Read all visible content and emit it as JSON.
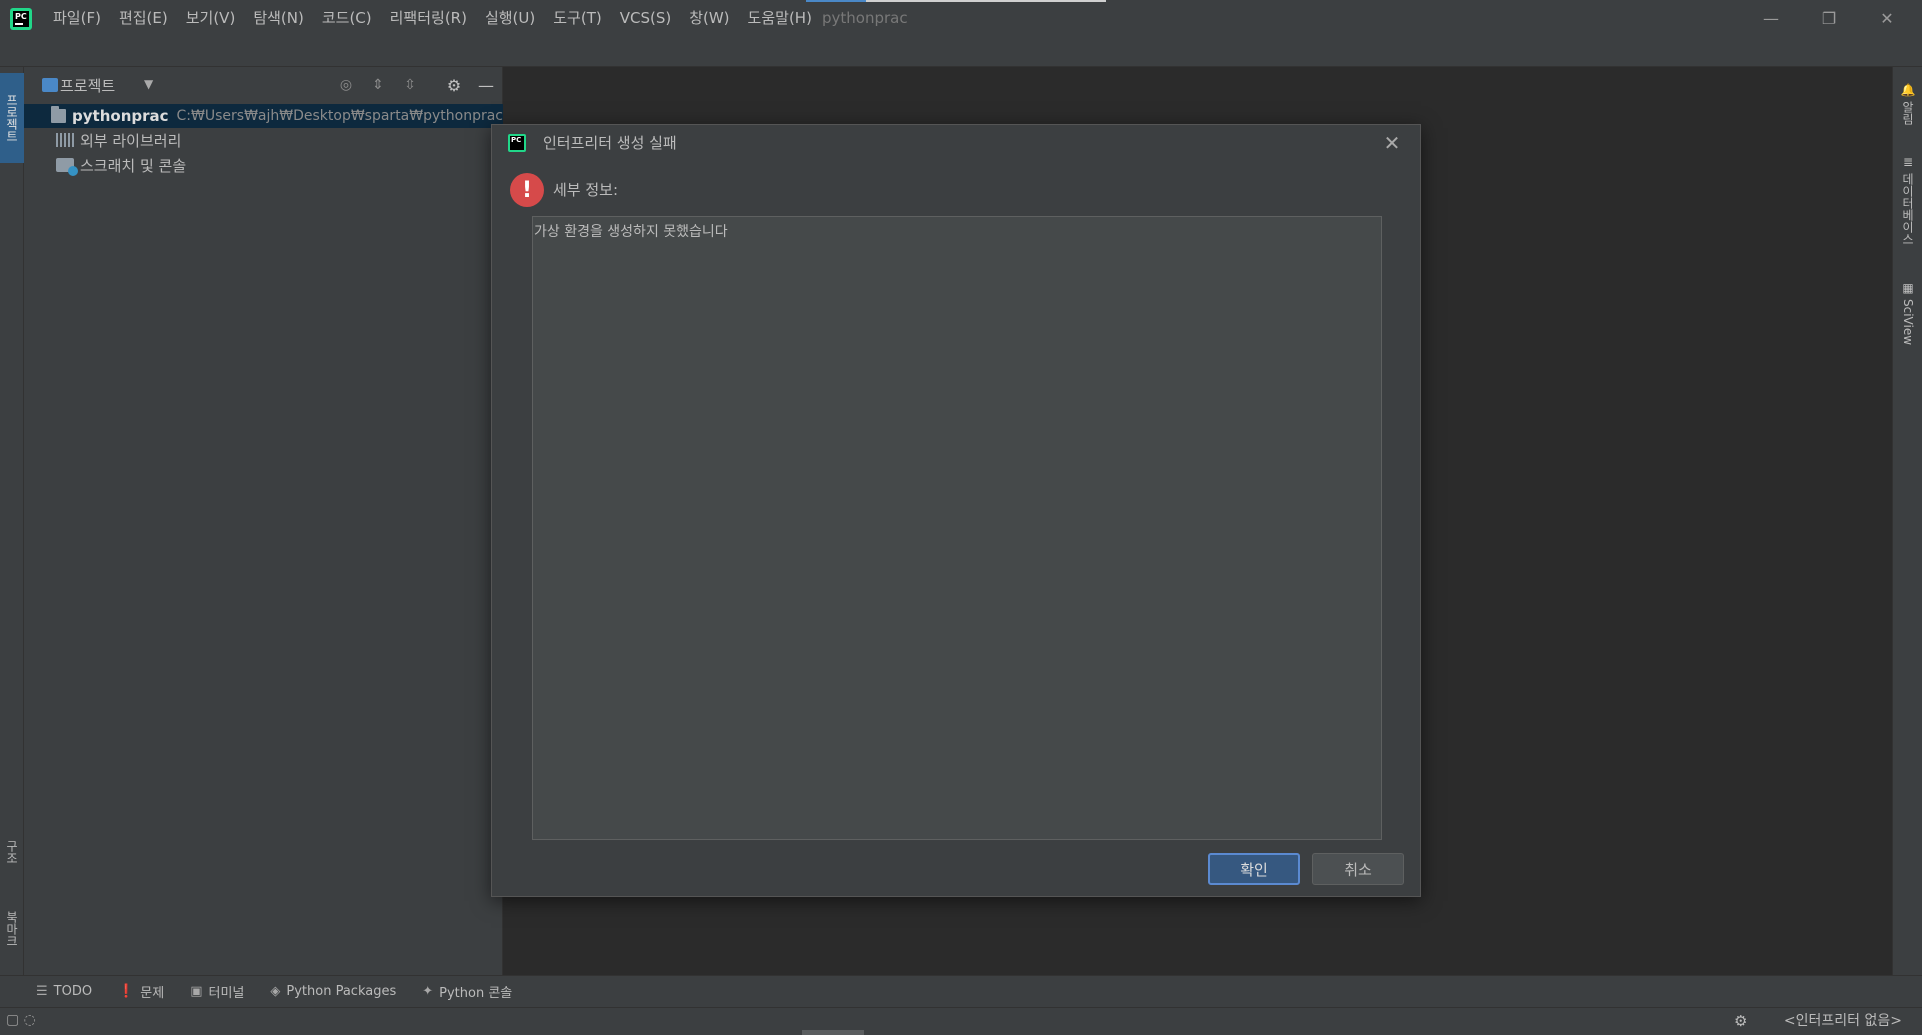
{
  "app": {
    "window_title": "pythonprac",
    "logo_text": "PC"
  },
  "menu": [
    "파일(F)",
    "편집(E)",
    "보기(V)",
    "탐색(N)",
    "코드(C)",
    "리팩터링(R)",
    "실행(U)",
    "도구(T)",
    "VCS(S)",
    "창(W)",
    "도움말(H)"
  ],
  "window_controls": {
    "minimize": "—",
    "restore": "❐",
    "close": "✕"
  },
  "left_stripe": {
    "project_tab": "프로젝트",
    "structure_tab": "구조",
    "bookmarks_tab": "북마크"
  },
  "project_panel": {
    "title": "프로젝트",
    "tree": {
      "root_name": "pythonprac",
      "root_path": "C:₩Users₩ajh₩Desktop₩sparta₩pythonprac",
      "external_libs": "외부 라이브러리",
      "scratches": "스크래치 및 콘솔"
    }
  },
  "right_stripe": {
    "notifications": "알림",
    "database": "데이터베이스",
    "sciview": "SciView"
  },
  "bottom_tabs": [
    {
      "icon": "☰",
      "label": "TODO"
    },
    {
      "icon": "❗",
      "label": "문제"
    },
    {
      "icon": "▣",
      "label": "터미널"
    },
    {
      "icon": "◈",
      "label": "Python Packages"
    },
    {
      "icon": "✦",
      "label": "Python 콘솔"
    }
  ],
  "status_bar": {
    "interpreter": "<인터프리터 없음>"
  },
  "dialog": {
    "title": "인터프리터 생성 실패",
    "details_label": "세부 정보:",
    "details_text": "가상 환경을 생성하지 못했습니다",
    "ok_label": "확인",
    "cancel_label": "취소",
    "error_icon": "!"
  },
  "colors": {
    "accent": "#365880",
    "selection": "#0d293e",
    "error": "#d64a4a",
    "brand": "#21d789"
  }
}
